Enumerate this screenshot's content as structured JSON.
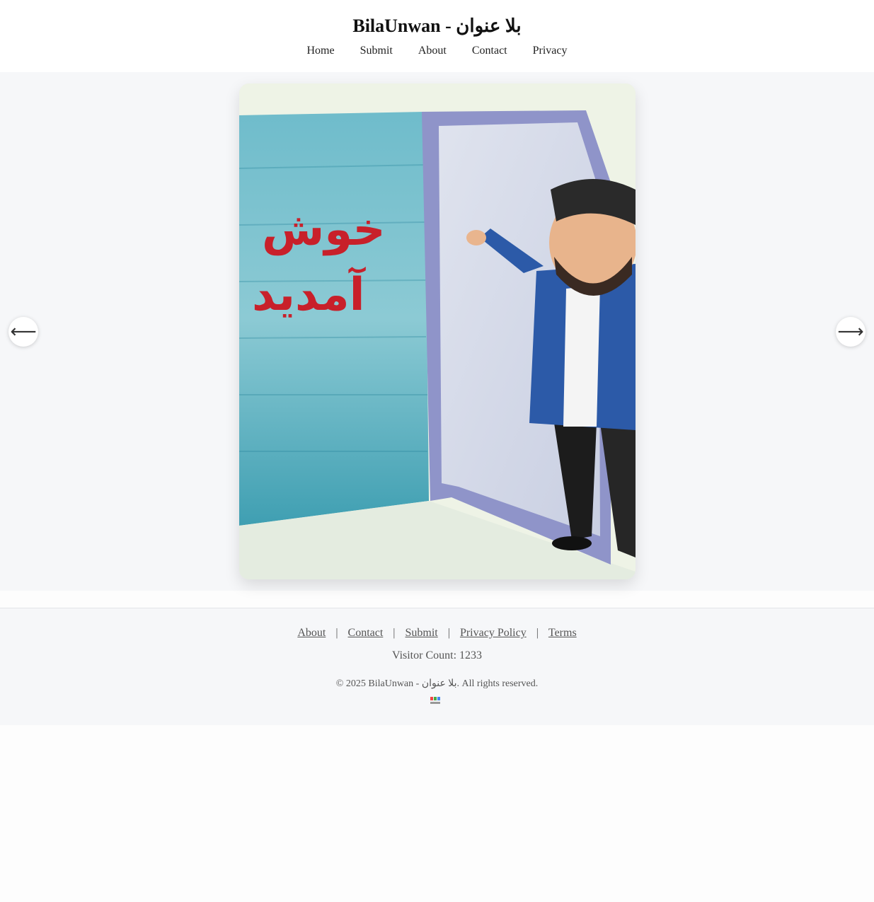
{
  "header": {
    "title": "BilaUnwan - بلا عنوان",
    "nav": [
      "Home",
      "Submit",
      "About",
      "Contact",
      "Privacy"
    ]
  },
  "slideshow": {
    "image_text_line1": "خوش",
    "image_text_line2": "آمدید",
    "prev_arrow": "⟵",
    "next_arrow": "⟶"
  },
  "footer": {
    "links": [
      "About",
      "Contact",
      "Submit",
      "Privacy Policy",
      "Terms"
    ],
    "separator": "|",
    "visitor_count": "Visitor Count: 1233",
    "copyright": "© 2025 BilaUnwan - بلا عنوان. All rights reserved."
  },
  "colors": {
    "header_bg": "#ffffff",
    "main_bg": "#f6f7f9",
    "image_text": "#c8202a",
    "wall": "#4aa3b5"
  },
  "icons": [
    "arrow-left-icon",
    "arrow-right-icon",
    "site-badge-icon"
  ]
}
